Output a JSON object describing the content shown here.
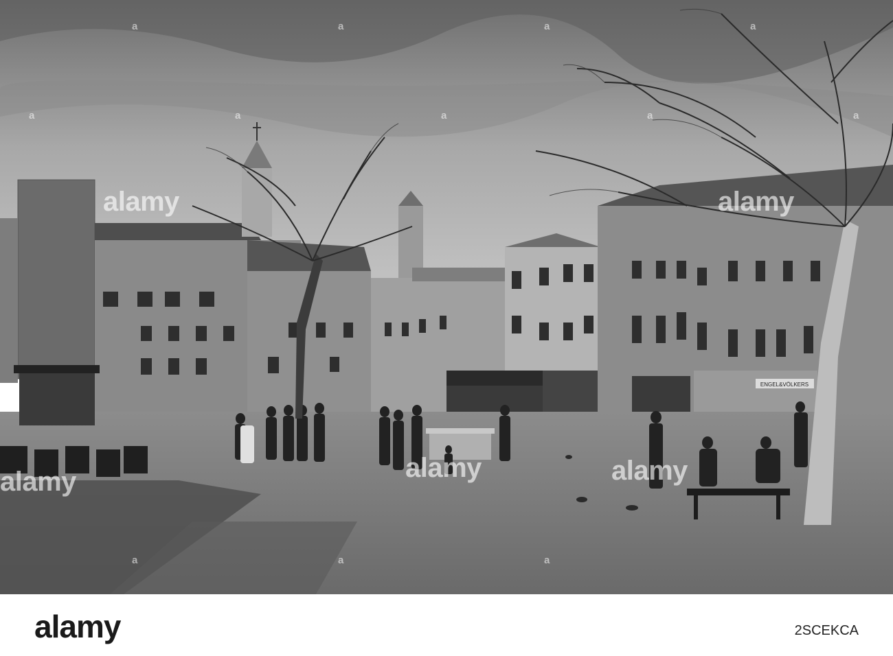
{
  "watermark": {
    "brand": "alamy",
    "small_marks": [
      "a",
      "a",
      "a",
      "a",
      "a",
      "a",
      "a",
      "a",
      "a",
      "a",
      "a",
      "a"
    ]
  },
  "footer": {
    "logo": "alamy",
    "stock_id": "2SCEKCA"
  },
  "storefronts": {
    "realtor": "ENGEL&VÖLKERS"
  },
  "palette": {
    "sky": "#9a9a9a",
    "ground": "#7a7a7a",
    "building": "#8e8e8e",
    "dark": "#2a2a2a"
  }
}
